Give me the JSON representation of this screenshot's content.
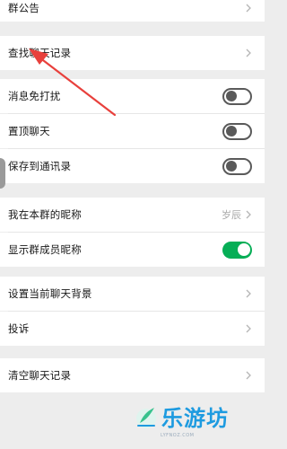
{
  "settings": {
    "rows": [
      {
        "label": "群公告"
      },
      {
        "label": "查找聊天记录"
      },
      {
        "label": "消息免打扰",
        "toggle": "off"
      },
      {
        "label": "置顶聊天",
        "toggle": "off"
      },
      {
        "label": "保存到通讯录",
        "toggle": "off"
      },
      {
        "label": "我在本群的昵称",
        "value": "岁辰"
      },
      {
        "label": "显示群成员昵称",
        "toggle": "on"
      },
      {
        "label": "设置当前聊天背景"
      },
      {
        "label": "投诉"
      },
      {
        "label": "清空聊天记录"
      }
    ]
  },
  "colors": {
    "page_bg": "#ededed",
    "row_bg": "#ffffff",
    "toggle_on": "#06ae56",
    "toggle_off": "#5a5a5a",
    "annotation_arrow": "#e8403c",
    "watermark": "#1e9be0"
  },
  "watermark": {
    "text": "乐游坊",
    "url": "LYFNOZ.COM"
  }
}
